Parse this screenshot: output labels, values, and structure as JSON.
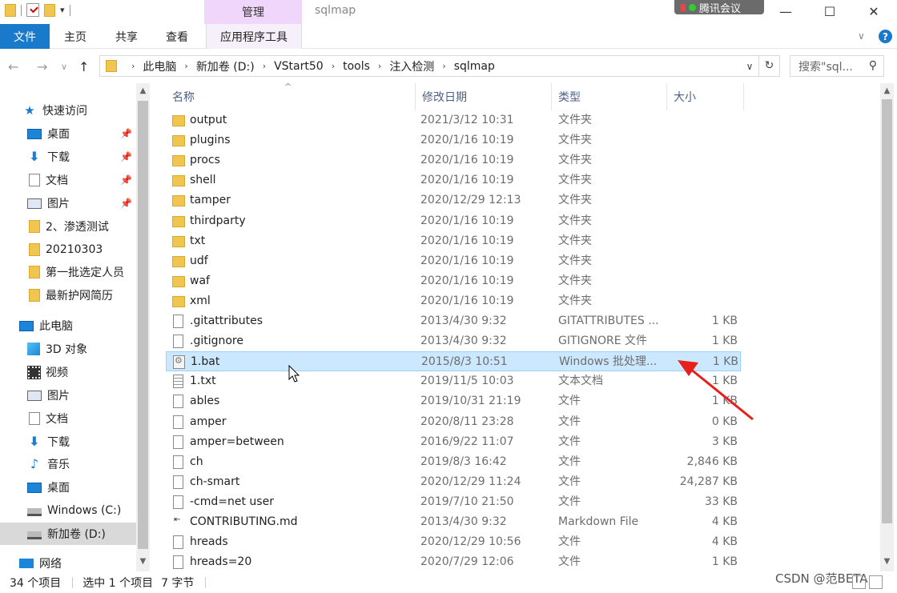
{
  "titlebar": {
    "context_tab": "管理",
    "window_title": "sqlmap",
    "meeting_label": "腾讯会议",
    "minimize": "—",
    "maximize": "☐",
    "close": "✕"
  },
  "ribbon": {
    "tabs": [
      "文件",
      "主页",
      "共享",
      "查看",
      "应用程序工具"
    ],
    "help": "?"
  },
  "address": {
    "path": [
      "此电脑",
      "新加卷 (D:)",
      "VStart50",
      "tools",
      "注入检测",
      "sqlmap"
    ],
    "search_placeholder": "搜索\"sql...",
    "icons": {
      "back": "back-arrow-icon",
      "forward": "forward-arrow-icon",
      "recent": "chevron-down-icon",
      "up": "up-arrow-icon",
      "refresh": "refresh-icon",
      "search": "search-icon"
    }
  },
  "sidebar": {
    "items": [
      {
        "label": "快速访问",
        "icon": "star",
        "pinned": false
      },
      {
        "label": "桌面",
        "icon": "desktop",
        "pinned": true
      },
      {
        "label": "下载",
        "icon": "download",
        "pinned": true
      },
      {
        "label": "文档",
        "icon": "document",
        "pinned": true
      },
      {
        "label": "图片",
        "icon": "picture",
        "pinned": true
      },
      {
        "label": "2、渗透测试",
        "icon": "folder",
        "pinned": false
      },
      {
        "label": "20210303",
        "icon": "folder",
        "pinned": false
      },
      {
        "label": "第一批选定人员",
        "icon": "folder",
        "pinned": false
      },
      {
        "label": "最新护网简历",
        "icon": "folder",
        "pinned": false
      },
      {
        "label": "此电脑",
        "icon": "pc",
        "pinned": false
      },
      {
        "label": "3D 对象",
        "icon": "3d",
        "pinned": false
      },
      {
        "label": "视频",
        "icon": "video",
        "pinned": false
      },
      {
        "label": "图片",
        "icon": "picture",
        "pinned": false
      },
      {
        "label": "文档",
        "icon": "document",
        "pinned": false
      },
      {
        "label": "下载",
        "icon": "download",
        "pinned": false
      },
      {
        "label": "音乐",
        "icon": "music",
        "pinned": false
      },
      {
        "label": "桌面",
        "icon": "desktop",
        "pinned": false
      },
      {
        "label": "Windows (C:)",
        "icon": "drive",
        "pinned": false
      },
      {
        "label": "新加卷 (D:)",
        "icon": "drive",
        "pinned": false,
        "selected": true
      },
      {
        "label": "网络",
        "icon": "network",
        "pinned": false
      }
    ]
  },
  "columns": {
    "name": "名称",
    "date": "修改日期",
    "type": "类型",
    "size": "大小"
  },
  "files": [
    {
      "name": "output",
      "date": "2021/3/12 10:31",
      "type": "文件夹",
      "size": "",
      "icon": "folder"
    },
    {
      "name": "plugins",
      "date": "2020/1/16 10:19",
      "type": "文件夹",
      "size": "",
      "icon": "folder"
    },
    {
      "name": "procs",
      "date": "2020/1/16 10:19",
      "type": "文件夹",
      "size": "",
      "icon": "folder"
    },
    {
      "name": "shell",
      "date": "2020/1/16 10:19",
      "type": "文件夹",
      "size": "",
      "icon": "folder"
    },
    {
      "name": "tamper",
      "date": "2020/12/29 12:13",
      "type": "文件夹",
      "size": "",
      "icon": "folder"
    },
    {
      "name": "thirdparty",
      "date": "2020/1/16 10:19",
      "type": "文件夹",
      "size": "",
      "icon": "folder"
    },
    {
      "name": "txt",
      "date": "2020/1/16 10:19",
      "type": "文件夹",
      "size": "",
      "icon": "folder"
    },
    {
      "name": "udf",
      "date": "2020/1/16 10:19",
      "type": "文件夹",
      "size": "",
      "icon": "folder"
    },
    {
      "name": "waf",
      "date": "2020/1/16 10:19",
      "type": "文件夹",
      "size": "",
      "icon": "folder"
    },
    {
      "name": "xml",
      "date": "2020/1/16 10:19",
      "type": "文件夹",
      "size": "",
      "icon": "folder"
    },
    {
      "name": ".gitattributes",
      "date": "2013/4/30 9:32",
      "type": "GITATTRIBUTES ...",
      "size": "1 KB",
      "icon": "file"
    },
    {
      "name": ".gitignore",
      "date": "2013/4/30 9:32",
      "type": "GITIGNORE 文件",
      "size": "1 KB",
      "icon": "file"
    },
    {
      "name": "1.bat",
      "date": "2015/8/3 10:51",
      "type": "Windows 批处理...",
      "size": "1 KB",
      "icon": "bat",
      "selected": true
    },
    {
      "name": "1.txt",
      "date": "2019/11/5 10:03",
      "type": "文本文档",
      "size": "1 KB",
      "icon": "txt"
    },
    {
      "name": "ables",
      "date": "2019/10/31 21:19",
      "type": "文件",
      "size": "1 KB",
      "icon": "file"
    },
    {
      "name": "amper",
      "date": "2020/8/11 23:28",
      "type": "文件",
      "size": "0 KB",
      "icon": "file"
    },
    {
      "name": "amper=between",
      "date": "2016/9/22 11:07",
      "type": "文件",
      "size": "3 KB",
      "icon": "file"
    },
    {
      "name": "ch",
      "date": "2019/8/3 16:42",
      "type": "文件",
      "size": "2,846 KB",
      "icon": "file"
    },
    {
      "name": "ch-smart",
      "date": "2020/12/29 11:24",
      "type": "文件",
      "size": "24,287 KB",
      "icon": "file"
    },
    {
      "name": "-cmd=net user",
      "date": "2019/7/10 21:50",
      "type": "文件",
      "size": "33 KB",
      "icon": "file"
    },
    {
      "name": "CONTRIBUTING.md",
      "date": "2013/4/30 9:32",
      "type": "Markdown File",
      "size": "4 KB",
      "icon": "md"
    },
    {
      "name": "hreads",
      "date": "2020/12/29 10:56",
      "type": "文件",
      "size": "4 KB",
      "icon": "file"
    },
    {
      "name": "hreads=20",
      "date": "2020/7/29 12:06",
      "type": "文件",
      "size": "1 KB",
      "icon": "file"
    }
  ],
  "status": {
    "item_count": "34 个项目",
    "selection": "选中 1 个项目",
    "selection_size": "7 字节"
  },
  "watermark": "CSDN @范BETA",
  "colors": {
    "accent": "#1979ca",
    "selected_row": "#cce8ff",
    "annotation_arrow": "#e8201c"
  }
}
